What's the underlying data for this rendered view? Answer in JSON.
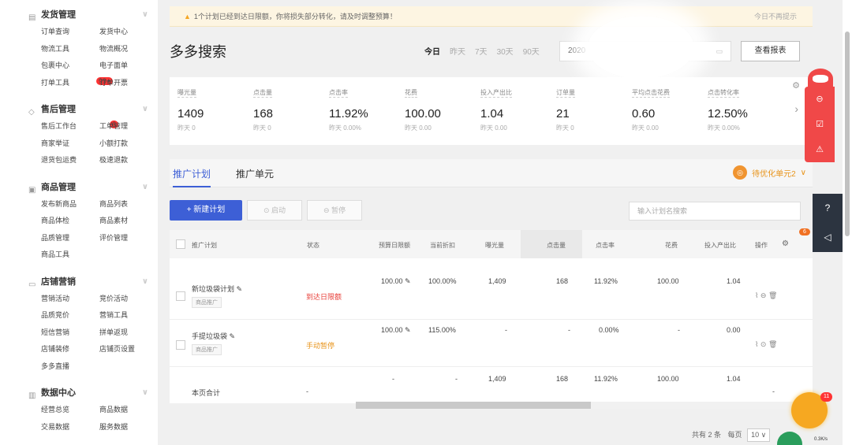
{
  "sidebar": {
    "sections": [
      {
        "title": "发货管理",
        "icon": "document-icon",
        "items": [
          "订单查询",
          "发货中心",
          "物流工具",
          "物流概况",
          "包裹中心",
          "电子面单",
          "打单工具",
          "订单开票"
        ]
      },
      {
        "title": "售后管理",
        "icon": "shield-icon",
        "items": [
          "售后工作台",
          "工单管理",
          "商家举证",
          "小额打款",
          "退货包运费",
          "极速退款"
        ]
      },
      {
        "title": "商品管理",
        "icon": "box-icon",
        "items": [
          "发布新商品",
          "商品列表",
          "商品体检",
          "商品素材",
          "品质管理",
          "评价管理",
          "商品工具"
        ]
      },
      {
        "title": "店铺营销",
        "icon": "store-icon",
        "items": [
          "营销活动",
          "竞价活动",
          "品质竞价",
          "营销工具",
          "短信营销",
          "拼单返现",
          "店铺装修",
          "店铺页设置",
          "多多直播"
        ]
      },
      {
        "title": "数据中心",
        "icon": "bar-chart-icon",
        "items": [
          "经营总览",
          "商品数据",
          "交易数据",
          "服务数据"
        ]
      }
    ],
    "hot_badge": "99+",
    "count_badge": "6"
  },
  "notice": {
    "text": "1个计划已经到达日限额，你将损失部分转化，请及时调整预算！",
    "close": "今日不再提示"
  },
  "header": {
    "title": "多多搜索",
    "date_tabs": [
      "今日",
      "昨天",
      "7天",
      "30天",
      "90天"
    ],
    "date_value": "2020",
    "report_button": "查看报表"
  },
  "metrics": [
    {
      "label": "曝光量",
      "value": "1409",
      "yesterday": "昨天 0"
    },
    {
      "label": "点击量",
      "value": "168",
      "yesterday": "昨天 0"
    },
    {
      "label": "点击率",
      "value": "11.92%",
      "yesterday": "昨天 0.00%"
    },
    {
      "label": "花费",
      "value": "100.00",
      "yesterday": "昨天 0.00"
    },
    {
      "label": "投入产出比",
      "value": "1.04",
      "yesterday": "昨天 0.00"
    },
    {
      "label": "订单量",
      "value": "21",
      "yesterday": "昨天 0"
    },
    {
      "label": "平均点击花费",
      "value": "0.60",
      "yesterday": "昨天 0.00"
    },
    {
      "label": "点击转化率",
      "value": "12.50%",
      "yesterday": "昨天 0.00%"
    }
  ],
  "tabs": {
    "plan": "推广计划",
    "unit": "推广单元",
    "optimize": "待优化单元2"
  },
  "toolbar": {
    "new_plan": "+ 新建计划",
    "start": "启动",
    "pause": "暂停",
    "search_placeholder": "输入计划名搜索"
  },
  "table": {
    "headers": {
      "plan": "推广计划",
      "status": "状态",
      "budget": "预算日限额",
      "discount": "当前折扣",
      "impressions": "曝光量",
      "clicks": "点击量",
      "ctr": "点击率",
      "cost": "花费",
      "roi": "投入产出比",
      "ops": "操作"
    },
    "rows": [
      {
        "name": "新垃圾袋计划",
        "tag": "商品推广",
        "status": "到达日限额",
        "budget": "100.00",
        "discount": "100.00%",
        "impressions": "1,409",
        "clicks": "168",
        "ctr": "11.92%",
        "cost": "100.00",
        "roi": "1.04"
      },
      {
        "name": "手提垃圾袋",
        "tag": "商品推广",
        "status": "手动暂停",
        "budget": "100.00",
        "discount": "115.00%",
        "impressions": "-",
        "clicks": "-",
        "ctr": "0.00%",
        "cost": "-",
        "roi": "0.00"
      }
    ],
    "total": {
      "label": "本页合计",
      "status": "-",
      "budget": "-",
      "discount": "-",
      "impressions": "1,409",
      "clicks": "168",
      "ctr": "11.92%",
      "cost": "100.00",
      "roi": "1.04",
      "ops": "-"
    }
  },
  "pagination": {
    "total": "共有 2 条",
    "per_page_label": "每页",
    "per_page": "10"
  },
  "right_tools": {
    "badge": "6",
    "avatar_badge": "11",
    "net": "0.3K/s"
  },
  "colors": {
    "primary": "#3d5fd6",
    "danger": "#e8413b",
    "warning": "#e8941b"
  }
}
